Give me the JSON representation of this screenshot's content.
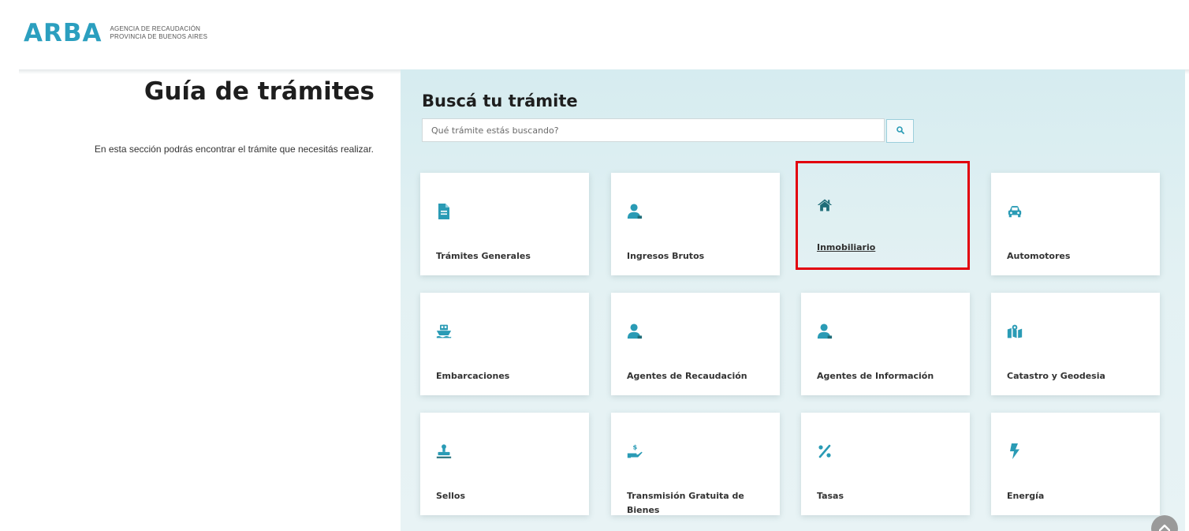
{
  "header": {
    "logo_text": "ARBA",
    "logo_sub_line1": "AGENCIA DE RECAUDACIÓN",
    "logo_sub_line2": "PROVINCIA DE BUENOS AIRES"
  },
  "intro": {
    "title": "Guía de trámites",
    "description": "En esta sección podrás encontrar el trámite que necesitás realizar."
  },
  "search": {
    "heading": "Buscá tu trámite",
    "placeholder": "Qué trámite estás buscando?",
    "button_icon": "search-icon"
  },
  "categories": [
    {
      "label": "Trámites Generales",
      "icon": "document-icon"
    },
    {
      "label": "Ingresos Brutos",
      "icon": "user-icon"
    },
    {
      "label": "Inmobiliario",
      "icon": "home-icon",
      "selected": true
    },
    {
      "label": "Automotores",
      "icon": "car-icon"
    },
    {
      "label": "Embarcaciones",
      "icon": "ship-icon"
    },
    {
      "label": "Agentes de Recaudación",
      "icon": "user-icon"
    },
    {
      "label": "Agentes de Información",
      "icon": "user-icon"
    },
    {
      "label": "Catastro y Geodesia",
      "icon": "map-icon"
    },
    {
      "label": "Sellos",
      "icon": "stamp-icon"
    },
    {
      "label": "Transmisión Gratuita de Bienes",
      "icon": "hand-dollar-icon"
    },
    {
      "label": "Tasas",
      "icon": "percent-icon"
    },
    {
      "label": "Energía",
      "icon": "bolt-icon"
    }
  ],
  "colors": {
    "brand": "#2b9fbf",
    "icon": "#2a9bb5",
    "home_icon": "#1f6d78",
    "highlight": "#e2000d",
    "panel_bg": "#e0f0f3"
  }
}
